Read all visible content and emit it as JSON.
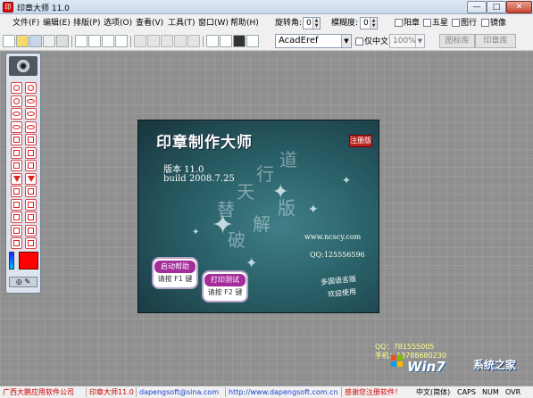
{
  "window": {
    "title": "印章大师 11.0",
    "min_label": "—",
    "max_label": "□",
    "close_label": "✕"
  },
  "menu": [
    "文件(F)",
    "编辑(E)",
    "排版(P)",
    "选项(O)",
    "查看(V)",
    "工具(T)",
    "窗口(W)",
    "帮助(H)"
  ],
  "panel": {
    "rotation_label": "旋转角:",
    "rotation_value": "0",
    "blur_label": "模糊度:",
    "blur_value": "0",
    "yang_label": "阳章",
    "wuxing_label": "五星",
    "tuoxing_label": "图行",
    "mirror_label": "镜像",
    "font_value": "AcadEref",
    "only_chinese_label": "仅中文",
    "zoom_value": "100%",
    "tabs": [
      "图标库",
      "印章库"
    ]
  },
  "splash": {
    "title": "印章制作大师",
    "reg": "注册版",
    "version": "版本 11.0",
    "build": "build 2008.7.25",
    "url": "www.ncscy.com",
    "qq": "QQ:125556596",
    "motto1": "多国语言版",
    "motto2": "欢迎使用",
    "help_btn": "启动帮助",
    "help_key": "请按 F1 键",
    "print_btn": "打印测试",
    "print_key": "请按 F2 键",
    "calligraphy": [
      "替",
      "天",
      "行",
      "道",
      "破",
      "解",
      "版"
    ]
  },
  "watermark": {
    "qq": "QQ：781555005",
    "phone": "手机：13788680230",
    "logo": "Win7",
    "brand": "系统之家"
  },
  "status": {
    "company": "广西大鹏应用软件公司",
    "product": "印章大师11.0",
    "email": "dapengsoft@sina.com",
    "url": "http://www.dapengsoft.com.cn",
    "notice": "感谢您注册软件！",
    "ime": "中文(简体)",
    "caps": "CAPS",
    "num": "NUM",
    "ovr": "OVR"
  },
  "colors": {
    "accent": "#ff0000",
    "status_red": "#cc0000",
    "link_blue": "#1a3fd0"
  }
}
